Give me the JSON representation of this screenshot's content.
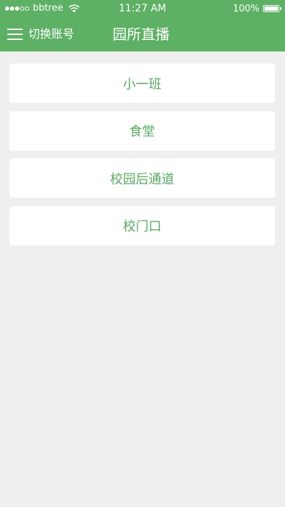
{
  "status_bar": {
    "carrier": "bbtree",
    "time": "11:27 AM",
    "battery": "100%",
    "signal_icon": "signal-dots-icon",
    "wifi_icon": "wifi-icon",
    "battery_icon": "battery-icon",
    "battery_level": 1.0
  },
  "nav": {
    "menu_icon": "hamburger-menu-icon",
    "menu_label": "切换账号",
    "title": "园所直播"
  },
  "list": {
    "items": [
      {
        "label": "小一班"
      },
      {
        "label": "食堂"
      },
      {
        "label": "校园后通道"
      },
      {
        "label": "校门口"
      }
    ]
  },
  "colors": {
    "header": "#5db064",
    "item_text": "#5aa863",
    "background": "#efefef",
    "card": "#ffffff"
  }
}
